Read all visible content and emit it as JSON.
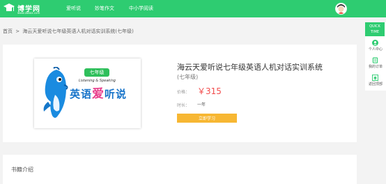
{
  "header": {
    "logo_name": "博学网",
    "logo_domain": "www.zbbox.com",
    "nav": [
      "爱听说",
      "妙笔作文",
      "中小学阅读"
    ]
  },
  "breadcrumb": {
    "home": "首页",
    "separator": ">",
    "current": "海云天爱听说七年级英语人机对话实训系统(七年级)"
  },
  "product": {
    "cover": {
      "grade_badge": "七年级",
      "tagline": "Listening & Speaking",
      "brand_part1": "英语",
      "brand_love": "爱",
      "brand_part2": "听说"
    },
    "title": "海云天爱听说七年级英语人机对话实训系统",
    "subtitle": "(七年级)",
    "price_label": "价格：",
    "price": "￥315",
    "duration_label": "时长：",
    "duration_value": "一年",
    "buy_button": "立即学习"
  },
  "intro": {
    "title": "书籍介绍"
  },
  "quick_time": {
    "header_line1": "QUICK",
    "header_line2": "TIME",
    "items": [
      "个人中心",
      "我的订单",
      "返回顶部"
    ]
  },
  "colors": {
    "brand_green": "#2ecc71",
    "price_red": "#f24c4c",
    "button_orange": "#f7b733"
  }
}
